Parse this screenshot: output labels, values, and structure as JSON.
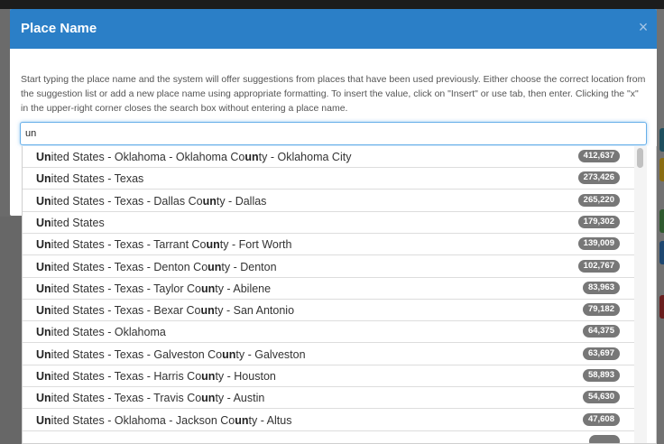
{
  "dialog": {
    "title": "Place Name",
    "close_label": "×",
    "instructions": "Start typing the place name and the system will offer suggestions from places that have been used previously. Either choose the correct location from the suggestion list or add a new place name using appropriate formatting. To insert the value, click on \"Insert\" or use tab, then enter. Clicking the \"x\" in the upper-right corner closes the search box without entering a place name."
  },
  "search": {
    "value": "un",
    "query": "un"
  },
  "suggestions": [
    {
      "label": "United States - Oklahoma - Oklahoma County - Oklahoma City",
      "count": "412,637"
    },
    {
      "label": "United States - Texas",
      "count": "273,426"
    },
    {
      "label": "United States - Texas - Dallas County - Dallas",
      "count": "265,220"
    },
    {
      "label": "United States",
      "count": "179,302"
    },
    {
      "label": "United States - Texas - Tarrant County - Fort Worth",
      "count": "139,009"
    },
    {
      "label": "United States - Texas - Denton County - Denton",
      "count": "102,767"
    },
    {
      "label": "United States - Texas - Taylor County - Abilene",
      "count": "83,963"
    },
    {
      "label": "United States - Texas - Bexar County - San Antonio",
      "count": "79,182"
    },
    {
      "label": "United States - Oklahoma",
      "count": "64,375"
    },
    {
      "label": "United States - Texas - Galveston County - Galveston",
      "count": "63,697"
    },
    {
      "label": "United States - Texas - Harris County - Houston",
      "count": "58,893"
    },
    {
      "label": "United States - Texas - Travis County - Austin",
      "count": "54,630"
    },
    {
      "label": "United States - Oklahoma - Jackson County - Altus",
      "count": "47,608"
    },
    {
      "label": "",
      "count": ""
    }
  ],
  "colors": {
    "header": "#2b7fc7",
    "badge": "#777777",
    "input_focus": "#66afe9"
  }
}
